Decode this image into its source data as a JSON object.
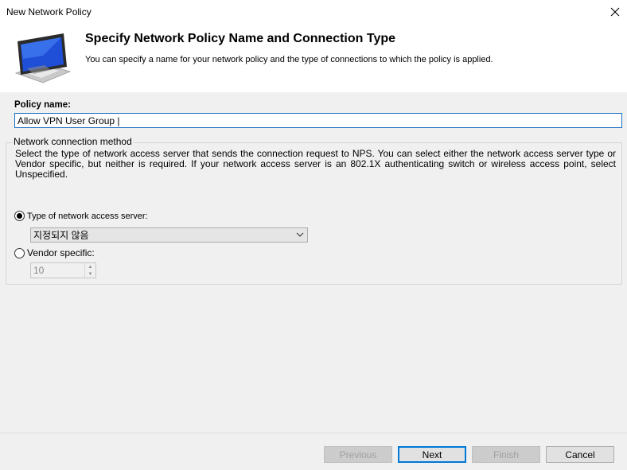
{
  "window": {
    "title": "New Network Policy",
    "close_icon": "close-icon"
  },
  "header": {
    "title": "Specify Network Policy Name and Connection Type",
    "subtitle": "You can specify a name for your network policy and the type of connections to which the policy is applied.",
    "icon": "computer-monitor-icon"
  },
  "policy": {
    "label": "Policy name:",
    "value": "Allow VPN User Group |"
  },
  "connection_method": {
    "legend": "Network connection method",
    "description": "Select the type of network access server that sends the connection request to NPS. You can select either the network access server type or Vendor specific, but neither is required.  If your network access server is an 802.1X authenticating switch or wireless access point, select Unspecified.",
    "type_radio_label": "Type of network access server:",
    "type_selected": true,
    "type_dropdown_value": "지정되지 않음",
    "vendor_radio_label": "Vendor specific:",
    "vendor_selected": false,
    "vendor_value": "10"
  },
  "footer": {
    "previous_label": "Previous",
    "next_label": "Next",
    "finish_label": "Finish",
    "cancel_label": "Cancel"
  },
  "colors": {
    "accent": "#0078d7",
    "panel_bg": "#f0f0f0",
    "disabled_btn": "#cccccc"
  }
}
